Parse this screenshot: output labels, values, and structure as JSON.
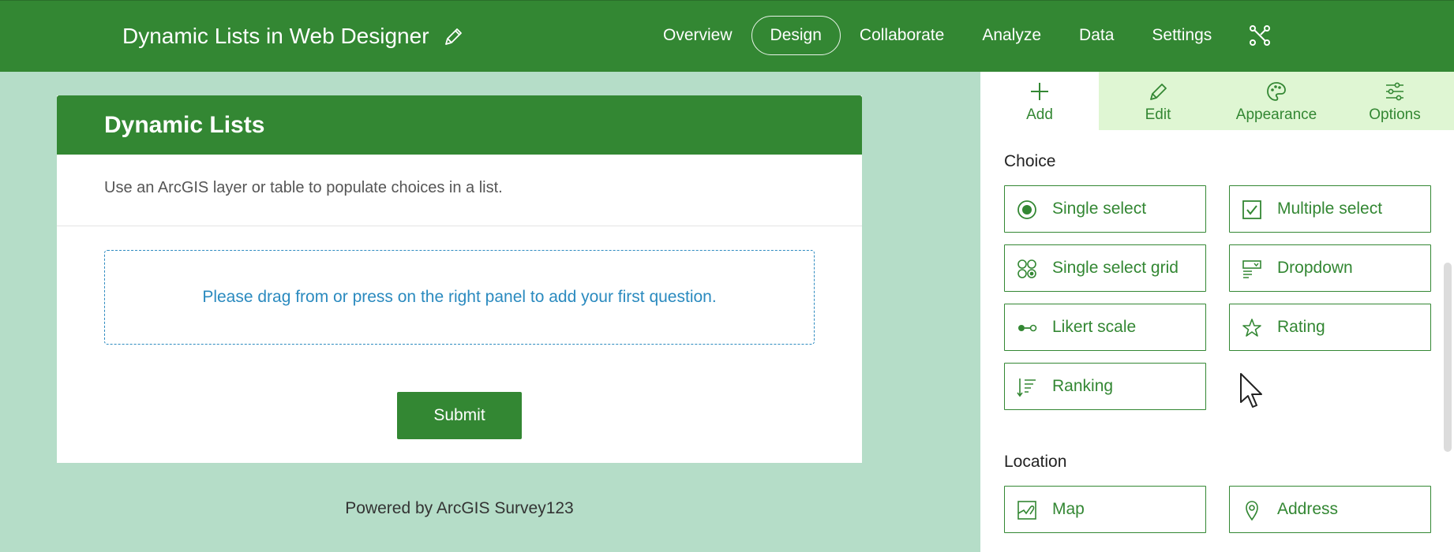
{
  "header": {
    "title": "Dynamic Lists in Web Designer",
    "nav": [
      {
        "label": "Overview"
      },
      {
        "label": "Design",
        "active": true
      },
      {
        "label": "Collaborate"
      },
      {
        "label": "Analyze"
      },
      {
        "label": "Data"
      },
      {
        "label": "Settings"
      }
    ],
    "edit_icon": "pencil-icon",
    "share_icon": "share-icon"
  },
  "form": {
    "title": "Dynamic Lists",
    "description": "Use an ArcGIS layer or table to populate choices in a list.",
    "dropzone_text": "Please drag from or press on the right panel to add your first question.",
    "submit_label": "Submit",
    "footer": "Powered by ArcGIS Survey123"
  },
  "panel": {
    "tabs": [
      {
        "label": "Add",
        "icon": "plus-icon",
        "active": true
      },
      {
        "label": "Edit",
        "icon": "pencil-icon"
      },
      {
        "label": "Appearance",
        "icon": "palette-icon"
      },
      {
        "label": "Options",
        "icon": "sliders-icon"
      }
    ],
    "sections": [
      {
        "title": "Choice",
        "items": [
          {
            "label": "Single select",
            "icon": "radio-icon"
          },
          {
            "label": "Multiple select",
            "icon": "checkbox-icon"
          },
          {
            "label": "Single select grid",
            "icon": "grid-icon"
          },
          {
            "label": "Dropdown",
            "icon": "dropdown-icon"
          },
          {
            "label": "Likert scale",
            "icon": "likert-icon"
          },
          {
            "label": "Rating",
            "icon": "star-icon"
          },
          {
            "label": "Ranking",
            "icon": "ranking-icon"
          }
        ]
      },
      {
        "title": "Location",
        "items": [
          {
            "label": "Map",
            "icon": "map-icon"
          },
          {
            "label": "Address",
            "icon": "pin-icon"
          }
        ]
      }
    ]
  },
  "colors": {
    "brand_green": "#338733",
    "background_mint": "#b5ddc8",
    "tab_inactive": "#dff6d3",
    "link_blue": "#2a8abf"
  }
}
